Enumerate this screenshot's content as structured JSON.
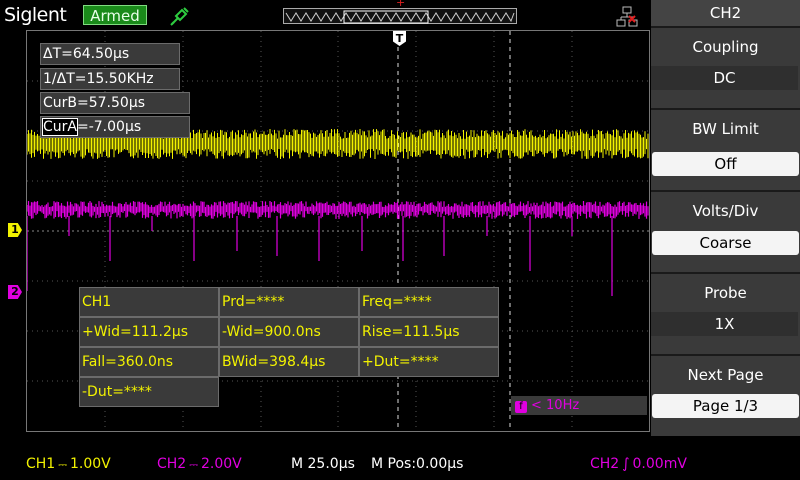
{
  "header": {
    "brand": "Siglent",
    "status": "Armed",
    "probe_icon": "probe-icon",
    "network_icon": "network-disconnected-icon",
    "trigger_marker": "T"
  },
  "cursors": {
    "delta_t": "ΔT=64.50µs",
    "inv_delta_t": "1/ΔT=15.50KHz",
    "cur_b": "CurB=57.50µs",
    "cur_a_label": "CurA",
    "cur_a_value": "=-7.00µs"
  },
  "measurements": {
    "source": "CH1",
    "prd": "Prd=****",
    "freq": "Freq=****",
    "pwid": "+Wid=111.2µs",
    "nwid": "-Wid=900.0ns",
    "rise": "Rise=111.5µs",
    "fall": "Fall=360.0ns",
    "bwid": "BWid=398.4µs",
    "pdut": "+Dut=****",
    "ndut": "-Dut=****"
  },
  "frequency_counter": {
    "icon": "f",
    "value": "< 10Hz"
  },
  "channel_markers": {
    "ch1": "1",
    "ch2": "2"
  },
  "menu": {
    "title": "CH2",
    "coupling_label": "Coupling",
    "coupling_value": "DC",
    "bw_label": "BW Limit",
    "bw_value": "Off",
    "vdiv_label": "Volts/Div",
    "vdiv_value": "Coarse",
    "probe_label": "Probe",
    "probe_value": "1X",
    "next_label": "Next Page",
    "next_value": "Page 1/3"
  },
  "status_bar": {
    "ch1": "CH1",
    "ch1_val": "1.00V",
    "ch2": "CH2",
    "ch2_val": "2.00V",
    "timebase": "M 25.0µs",
    "mpos": "M Pos:0.00µs",
    "trigger": "CH2",
    "trigger_level": "0.00mV"
  },
  "colors": {
    "ch1": "#f2f200",
    "ch2": "#e000e0",
    "armed": "#1a8a1a"
  }
}
